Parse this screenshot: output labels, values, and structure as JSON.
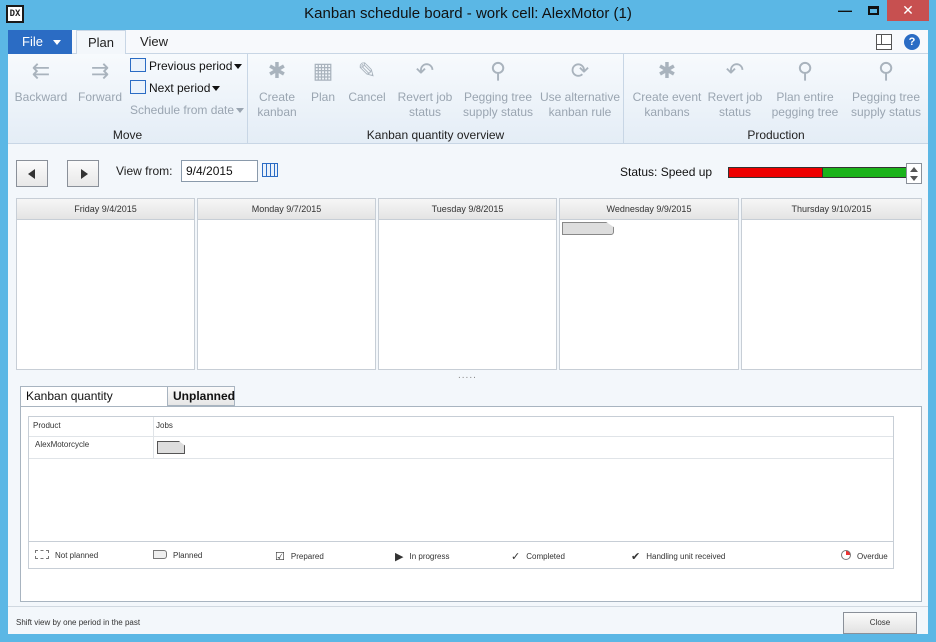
{
  "window": {
    "title": "Kanban schedule board - work cell: AlexMotor (1)",
    "app_icon_label": "DX",
    "min_glyph": "—",
    "close_glyph": "✕"
  },
  "ribbon": {
    "tabs": {
      "file": "File",
      "plan": "Plan",
      "view": "View"
    },
    "help_glyph": "?",
    "groups": {
      "move": {
        "label": "Move",
        "backward": "Backward",
        "forward": "Forward",
        "previous_period": "Previous period",
        "next_period": "Next period",
        "schedule_from_date": "Schedule from date"
      },
      "kanban": {
        "label": "Kanban quantity overview",
        "create_kanban": [
          "Create",
          "kanban"
        ],
        "plan": "Plan",
        "cancel": "Cancel",
        "revert_job_status": [
          "Revert job",
          "status"
        ],
        "pegging_tree": [
          "Pegging tree",
          "supply status"
        ],
        "alt_rule": [
          "Use alternative",
          "kanban rule"
        ]
      },
      "production": {
        "label": "Production",
        "create_event": [
          "Create event",
          "kanbans"
        ],
        "revert_job_status": [
          "Revert job",
          "status"
        ],
        "plan_pegging": [
          "Plan entire",
          "pegging tree"
        ],
        "pegging_tree": [
          "Pegging tree",
          "supply status"
        ]
      }
    }
  },
  "toolbar": {
    "view_from_label": "View from:",
    "view_from_value": "9/4/2015",
    "status_label": "Status: Speed up",
    "status_level": 0.52,
    "colors": {
      "slow": "#ee0000",
      "speed_up": "#1bb31b"
    }
  },
  "board": {
    "days": [
      "Friday 9/4/2015",
      "Monday 9/7/2015",
      "Tuesday 9/8/2015",
      "Wednesday 9/9/2015",
      "Thursday 9/10/2015"
    ],
    "splitter_glyph": "....."
  },
  "lower": {
    "tabs": {
      "overview": "Kanban quantity overview",
      "unplanned": "Unplanned"
    },
    "grid": {
      "columns": {
        "product": "Product",
        "jobs": "Jobs"
      },
      "rows": [
        {
          "product": "AlexMotorcycle"
        }
      ]
    },
    "legend": {
      "not_planned": "Not planned",
      "planned": "Planned",
      "prepared": "Prepared",
      "in_progress": "In progress",
      "completed": "Completed",
      "handling_unit_received": "Handling unit received",
      "overdue": "Overdue"
    }
  },
  "footer": {
    "status_text": "Shift view by one period in the past",
    "close_label": "Close"
  }
}
